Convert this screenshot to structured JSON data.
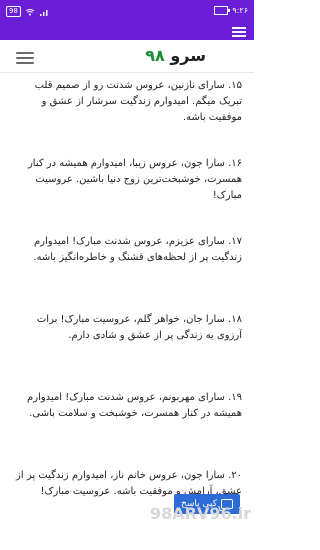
{
  "status_bar": {
    "time": "۹:۲۶",
    "battery_level": "98",
    "icons": [
      "battery-icon",
      "signal-icon",
      "wifi-icon"
    ]
  },
  "header": {
    "title_prefix": "سرو",
    "title_suffix": "۹۸",
    "menu_icon": "hamburger-icon"
  },
  "wishes": [
    {
      "text": "۱۵. سارای نازنین، عروس شدنت رو از صمیم قلب تبریک میگم. امیدوارم زندگیت سرشار از عشق و موفقیت باشه."
    },
    {
      "text": "۱۶. سارا جون، عروس زیبا، امیدوارم همیشه در کنار همسرت، خوشبخت‌ترین زوج دنیا باشین. عروسیت مبارک!"
    },
    {
      "text": "۱۷. سارای عزیزم، عروس شدنت مبارک! امیدوارم زندگیت پر از لحظه‌های قشنگ و خاطره‌انگیز باشه."
    },
    {
      "text": "۱۸. سارا جان، خواهر گلم، عروسیت مبارک! برات آرزوی یه زندگی پر از عشق و شادی دارم."
    },
    {
      "text": "۱۹. سارای مهربونم، عروس شدنت مبارک! امیدوارم همیشه در کنار همسرت، خوشبخت و سلامت باشی."
    },
    {
      "text": "۲۰. سارا جون، عروس خانم ناز، امیدوارم زندگیت پر از عشق، آرامش و موفقیت باشه. عروسیت مبارک!"
    }
  ],
  "reply_button": {
    "label": "کپی پاسخ",
    "icon": "copy-icon"
  },
  "watermark": {
    "text": "98ARV96.ir"
  },
  "colors": {
    "accent": "#6a1fd6",
    "title_number": "#1f8b3b",
    "reply_button": "#2d6cd8"
  }
}
